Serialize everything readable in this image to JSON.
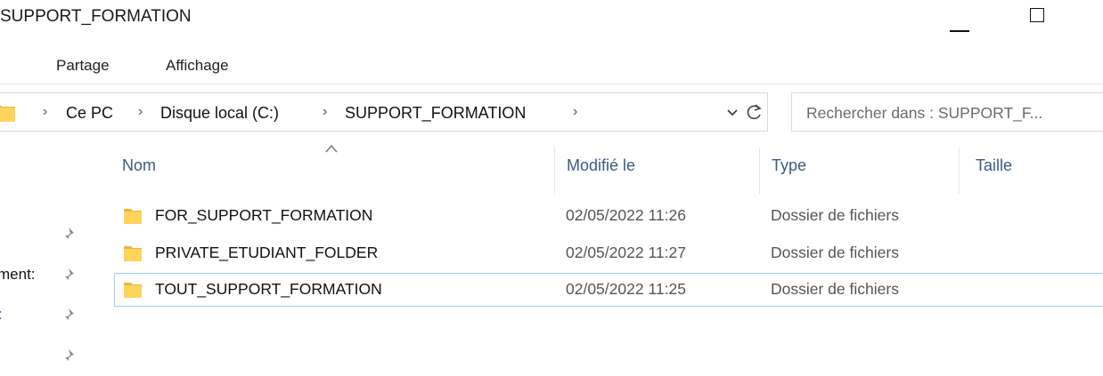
{
  "window": {
    "title": "SUPPORT_FORMATION"
  },
  "ribbon": {
    "tabs": [
      "Partage",
      "Affichage"
    ]
  },
  "address": {
    "breadcrumbs": [
      "Ce PC",
      "Disque local (C:)",
      "SUPPORT_FORMATION"
    ],
    "separator": "›",
    "trailing_separator": "›",
    "dropdown_glyph": "⌵"
  },
  "search": {
    "placeholder": "Rechercher dans : SUPPORT_F..."
  },
  "columns": {
    "name": "Nom",
    "modified": "Modifié le",
    "type": "Type",
    "size": "Taille"
  },
  "files": [
    {
      "name": "FOR_SUPPORT_FORMATION",
      "modified": "02/05/2022 11:26",
      "type": "Dossier de fichiers",
      "icon": "folder-icon"
    },
    {
      "name": "PRIVATE_ETUDIANT_FOLDER",
      "modified": "02/05/2022 11:27",
      "type": "Dossier de fichiers",
      "icon": "folder-icon"
    },
    {
      "name": "TOUT_SUPPORT_FORMATION",
      "modified": "02/05/2022 11:25",
      "type": "Dossier de fichiers",
      "icon": "folder-icon",
      "selected": true
    }
  ],
  "nav": {
    "items": [
      {
        "label": "",
        "icon": "pin-icon"
      },
      {
        "label": "ment:",
        "icon": "pin-icon"
      },
      {
        "label": ":",
        "icon": "pin-icon"
      },
      {
        "label": "",
        "icon": "pin-icon"
      }
    ]
  },
  "colors": {
    "folder": "#ffd35c",
    "folder_dark": "#e8b931",
    "header_text": "#3d5a80",
    "selection_border": "#99d1ff",
    "nav_link": "#1f6fbf"
  }
}
